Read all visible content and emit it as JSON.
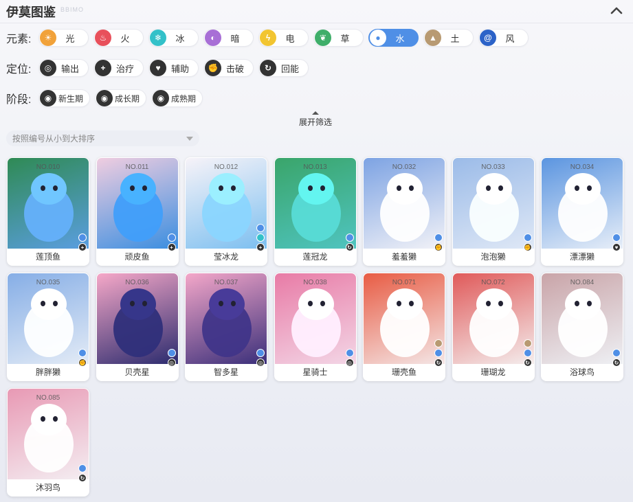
{
  "header": {
    "title": "伊莫图鉴",
    "deco": "BBIMO"
  },
  "filters": {
    "element_label": "元素:",
    "elements": [
      {
        "label": "光",
        "glyph": "☀",
        "color": "#f1a23a",
        "icon": "light-icon",
        "selected": false
      },
      {
        "label": "火",
        "glyph": "♨",
        "color": "#e8505b",
        "icon": "fire-icon",
        "selected": false
      },
      {
        "label": "冰",
        "glyph": "❄",
        "color": "#33c1c9",
        "icon": "ice-icon",
        "selected": false
      },
      {
        "label": "暗",
        "glyph": "◐",
        "color": "#a86fd6",
        "icon": "dark-icon",
        "selected": false
      },
      {
        "label": "电",
        "glyph": "ϟ",
        "color": "#f2c531",
        "icon": "electric-icon",
        "selected": false
      },
      {
        "label": "草",
        "glyph": "❦",
        "color": "#3fae6a",
        "icon": "grass-icon",
        "selected": false
      },
      {
        "label": "水",
        "glyph": "●",
        "color": "#4f8fe6",
        "icon": "water-icon",
        "selected": true
      },
      {
        "label": "土",
        "glyph": "▲",
        "color": "#b89a72",
        "icon": "earth-icon",
        "selected": false
      },
      {
        "label": "风",
        "glyph": "@",
        "color": "#2c63c8",
        "icon": "wind-icon",
        "selected": false
      }
    ],
    "position_label": "定位:",
    "positions": [
      {
        "label": "输出",
        "glyph": "◎",
        "icon": "output-icon"
      },
      {
        "label": "治疗",
        "glyph": "+",
        "icon": "heal-icon"
      },
      {
        "label": "辅助",
        "glyph": "♥",
        "icon": "support-icon"
      },
      {
        "label": "击破",
        "glyph": "✊",
        "icon": "break-icon"
      },
      {
        "label": "回能",
        "glyph": "↻",
        "icon": "energy-icon"
      }
    ],
    "stage_label": "阶段:",
    "stages": [
      {
        "label": "新生期",
        "glyph": "◉",
        "icon": "newborn-icon"
      },
      {
        "label": "成长期",
        "glyph": "◉",
        "icon": "growth-icon"
      },
      {
        "label": "成熟期",
        "glyph": "◉",
        "icon": "mature-icon"
      }
    ],
    "expand_label": "展开筛选",
    "sort_label": "按照编号从小到大排序"
  },
  "cards": [
    {
      "no": "NO.010",
      "name": "莲顶鱼",
      "el_color": "#4f8fe6",
      "el2_color": "",
      "role_glyph": "+",
      "bg": "#5a9ee0",
      "bg2": "#2f8a54"
    },
    {
      "no": "NO.011",
      "name": "顽皮鱼",
      "el_color": "#4f8fe6",
      "el2_color": "",
      "role_glyph": "+",
      "bg": "#3a8ee0",
      "bg2": "#f0cde0"
    },
    {
      "no": "NO.012",
      "name": "莹冰龙",
      "el_color": "#4f8fe6",
      "el2_color": "#33c1c9",
      "role_glyph": "+",
      "bg": "#7cbff0",
      "bg2": "#f7f3f8"
    },
    {
      "no": "NO.013",
      "name": "莲冠龙",
      "el_color": "#4f8fe6",
      "el2_color": "",
      "role_glyph": "↻",
      "bg": "#4fc4c0",
      "bg2": "#3aa56a"
    },
    {
      "no": "NO.032",
      "name": "羞羞獭",
      "el_color": "#4f8fe6",
      "el2_color": "",
      "role_glyph": "✊",
      "bg": "#f2f2f7",
      "bg2": "#7da3e3"
    },
    {
      "no": "NO.033",
      "name": "泡泡獭",
      "el_color": "#4f8fe6",
      "el2_color": "",
      "role_glyph": "✊",
      "bg": "#dfe8f6",
      "bg2": "#9bbbe8"
    },
    {
      "no": "NO.034",
      "name": "漂漂獭",
      "el_color": "#4f8fe6",
      "el2_color": "",
      "role_glyph": "♥",
      "bg": "#e7eef8",
      "bg2": "#5b95e0"
    },
    {
      "no": "NO.035",
      "name": "胖胖獭",
      "el_color": "#4f8fe6",
      "el2_color": "",
      "role_glyph": "✊",
      "bg": "#e3ebf6",
      "bg2": "#86aee6"
    },
    {
      "no": "NO.036",
      "name": "贝壳星",
      "el_color": "#4f8fe6",
      "el2_color": "",
      "role_glyph": "◎",
      "bg": "#2b2b6e",
      "bg2": "#f6a8c8"
    },
    {
      "no": "NO.037",
      "name": "智多星",
      "el_color": "#4f8fe6",
      "el2_color": "",
      "role_glyph": "◎",
      "bg": "#3a2f7a",
      "bg2": "#f4a7c9"
    },
    {
      "no": "NO.038",
      "name": "星骑士",
      "el_color": "#4f8fe6",
      "el2_color": "",
      "role_glyph": "◎",
      "bg": "#f3d6e6",
      "bg2": "#e87ba6"
    },
    {
      "no": "NO.071",
      "name": "珊壳鱼",
      "el_color": "#b89a72",
      "el2_color": "#4f8fe6",
      "role_glyph": "↻",
      "bg": "#f4e6e6",
      "bg2": "#e85c44"
    },
    {
      "no": "NO.072",
      "name": "珊瑚龙",
      "el_color": "#b89a72",
      "el2_color": "#4f8fe6",
      "role_glyph": "↻",
      "bg": "#f4eded",
      "bg2": "#e05a5a"
    },
    {
      "no": "NO.084",
      "name": "浴球鸟",
      "el_color": "#4f8fe6",
      "el2_color": "",
      "role_glyph": "↻",
      "bg": "#eef0f4",
      "bg2": "#c9a4a8"
    },
    {
      "no": "NO.085",
      "name": "沐羽鸟",
      "el_color": "#4f8fe6",
      "el2_color": "",
      "role_glyph": "↻",
      "bg": "#f4eef2",
      "bg2": "#e899b4"
    }
  ]
}
